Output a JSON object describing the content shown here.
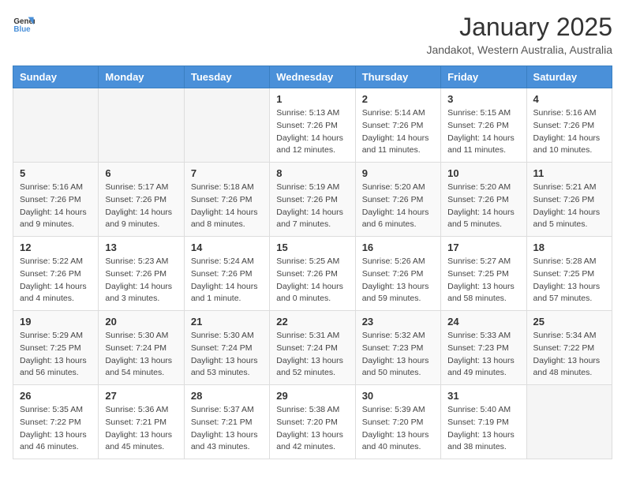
{
  "header": {
    "logo_general": "General",
    "logo_blue": "Blue",
    "month_year": "January 2025",
    "location": "Jandakot, Western Australia, Australia"
  },
  "days_of_week": [
    "Sunday",
    "Monday",
    "Tuesday",
    "Wednesday",
    "Thursday",
    "Friday",
    "Saturday"
  ],
  "weeks": [
    [
      {
        "day": "",
        "info": ""
      },
      {
        "day": "",
        "info": ""
      },
      {
        "day": "",
        "info": ""
      },
      {
        "day": "1",
        "info": "Sunrise: 5:13 AM\nSunset: 7:26 PM\nDaylight: 14 hours and 12 minutes."
      },
      {
        "day": "2",
        "info": "Sunrise: 5:14 AM\nSunset: 7:26 PM\nDaylight: 14 hours and 11 minutes."
      },
      {
        "day": "3",
        "info": "Sunrise: 5:15 AM\nSunset: 7:26 PM\nDaylight: 14 hours and 11 minutes."
      },
      {
        "day": "4",
        "info": "Sunrise: 5:16 AM\nSunset: 7:26 PM\nDaylight: 14 hours and 10 minutes."
      }
    ],
    [
      {
        "day": "5",
        "info": "Sunrise: 5:16 AM\nSunset: 7:26 PM\nDaylight: 14 hours and 9 minutes."
      },
      {
        "day": "6",
        "info": "Sunrise: 5:17 AM\nSunset: 7:26 PM\nDaylight: 14 hours and 9 minutes."
      },
      {
        "day": "7",
        "info": "Sunrise: 5:18 AM\nSunset: 7:26 PM\nDaylight: 14 hours and 8 minutes."
      },
      {
        "day": "8",
        "info": "Sunrise: 5:19 AM\nSunset: 7:26 PM\nDaylight: 14 hours and 7 minutes."
      },
      {
        "day": "9",
        "info": "Sunrise: 5:20 AM\nSunset: 7:26 PM\nDaylight: 14 hours and 6 minutes."
      },
      {
        "day": "10",
        "info": "Sunrise: 5:20 AM\nSunset: 7:26 PM\nDaylight: 14 hours and 5 minutes."
      },
      {
        "day": "11",
        "info": "Sunrise: 5:21 AM\nSunset: 7:26 PM\nDaylight: 14 hours and 5 minutes."
      }
    ],
    [
      {
        "day": "12",
        "info": "Sunrise: 5:22 AM\nSunset: 7:26 PM\nDaylight: 14 hours and 4 minutes."
      },
      {
        "day": "13",
        "info": "Sunrise: 5:23 AM\nSunset: 7:26 PM\nDaylight: 14 hours and 3 minutes."
      },
      {
        "day": "14",
        "info": "Sunrise: 5:24 AM\nSunset: 7:26 PM\nDaylight: 14 hours and 1 minute."
      },
      {
        "day": "15",
        "info": "Sunrise: 5:25 AM\nSunset: 7:26 PM\nDaylight: 14 hours and 0 minutes."
      },
      {
        "day": "16",
        "info": "Sunrise: 5:26 AM\nSunset: 7:26 PM\nDaylight: 13 hours and 59 minutes."
      },
      {
        "day": "17",
        "info": "Sunrise: 5:27 AM\nSunset: 7:25 PM\nDaylight: 13 hours and 58 minutes."
      },
      {
        "day": "18",
        "info": "Sunrise: 5:28 AM\nSunset: 7:25 PM\nDaylight: 13 hours and 57 minutes."
      }
    ],
    [
      {
        "day": "19",
        "info": "Sunrise: 5:29 AM\nSunset: 7:25 PM\nDaylight: 13 hours and 56 minutes."
      },
      {
        "day": "20",
        "info": "Sunrise: 5:30 AM\nSunset: 7:24 PM\nDaylight: 13 hours and 54 minutes."
      },
      {
        "day": "21",
        "info": "Sunrise: 5:30 AM\nSunset: 7:24 PM\nDaylight: 13 hours and 53 minutes."
      },
      {
        "day": "22",
        "info": "Sunrise: 5:31 AM\nSunset: 7:24 PM\nDaylight: 13 hours and 52 minutes."
      },
      {
        "day": "23",
        "info": "Sunrise: 5:32 AM\nSunset: 7:23 PM\nDaylight: 13 hours and 50 minutes."
      },
      {
        "day": "24",
        "info": "Sunrise: 5:33 AM\nSunset: 7:23 PM\nDaylight: 13 hours and 49 minutes."
      },
      {
        "day": "25",
        "info": "Sunrise: 5:34 AM\nSunset: 7:22 PM\nDaylight: 13 hours and 48 minutes."
      }
    ],
    [
      {
        "day": "26",
        "info": "Sunrise: 5:35 AM\nSunset: 7:22 PM\nDaylight: 13 hours and 46 minutes."
      },
      {
        "day": "27",
        "info": "Sunrise: 5:36 AM\nSunset: 7:21 PM\nDaylight: 13 hours and 45 minutes."
      },
      {
        "day": "28",
        "info": "Sunrise: 5:37 AM\nSunset: 7:21 PM\nDaylight: 13 hours and 43 minutes."
      },
      {
        "day": "29",
        "info": "Sunrise: 5:38 AM\nSunset: 7:20 PM\nDaylight: 13 hours and 42 minutes."
      },
      {
        "day": "30",
        "info": "Sunrise: 5:39 AM\nSunset: 7:20 PM\nDaylight: 13 hours and 40 minutes."
      },
      {
        "day": "31",
        "info": "Sunrise: 5:40 AM\nSunset: 7:19 PM\nDaylight: 13 hours and 38 minutes."
      },
      {
        "day": "",
        "info": ""
      }
    ]
  ]
}
